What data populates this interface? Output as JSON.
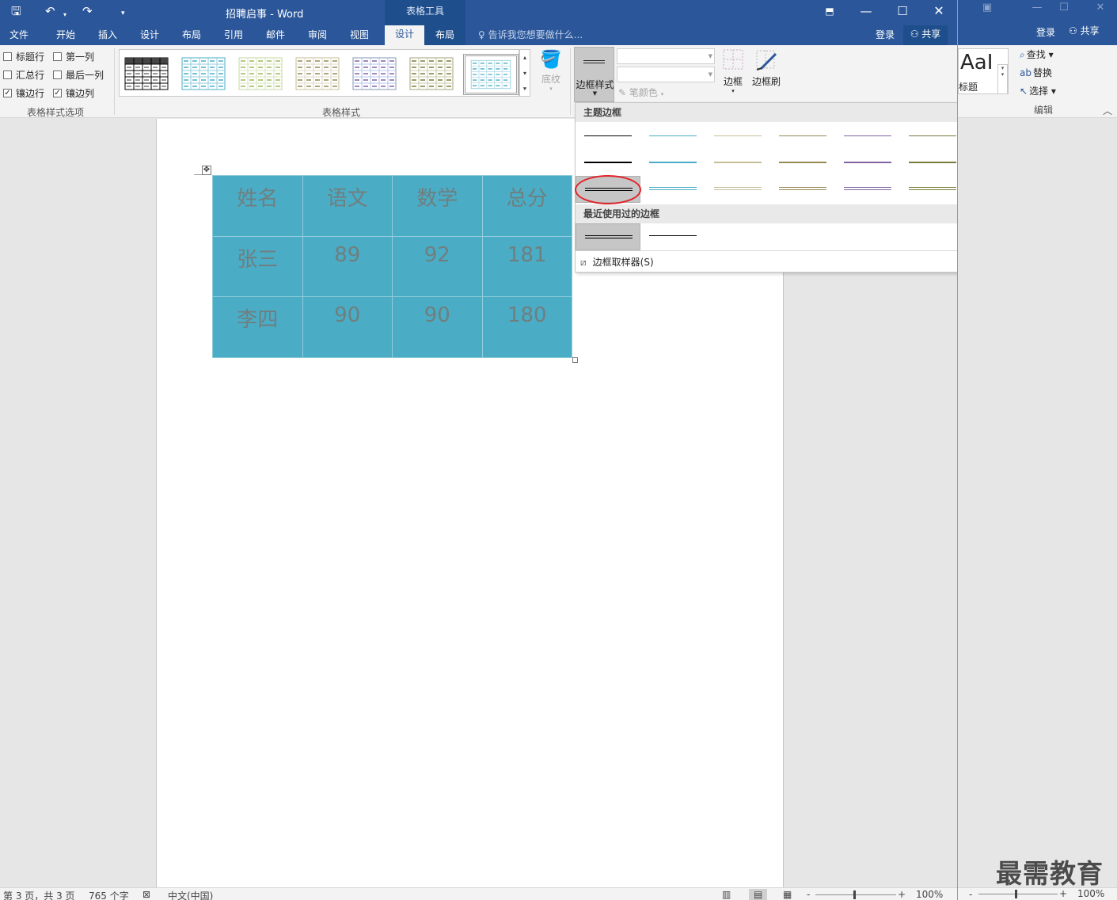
{
  "window": {
    "title": "招聘启事 - Word",
    "context_tool": "表格工具",
    "tabs": [
      "文件",
      "开始",
      "插入",
      "设计",
      "布局",
      "引用",
      "邮件",
      "审阅",
      "视图",
      "设计",
      "布局"
    ],
    "tell_me": "告诉我您想要做什么...",
    "login": "登录",
    "share": "共享"
  },
  "ribbon": {
    "options": {
      "header_row": "标题行",
      "first_col": "第一列",
      "total_row": "汇总行",
      "last_col": "最后一列",
      "banded_rows": "镶边行",
      "banded_cols": "镶边列",
      "checked": [
        "banded_rows",
        "banded_cols"
      ],
      "group_label": "表格样式选项"
    },
    "styles_group_label": "表格样式",
    "shading": "底纹",
    "border_style": "边框样式",
    "pen_color": "笔颜色",
    "borders": "边框",
    "border_painter": "边框刷"
  },
  "table": {
    "rows": [
      [
        "姓名",
        "语文",
        "数学",
        "总分"
      ],
      [
        "张三",
        "89",
        "92",
        "181"
      ],
      [
        "李四",
        "90",
        "90",
        "180"
      ]
    ],
    "fill_color": "#4bacc6",
    "text_color": "#6f7f7f"
  },
  "dropdown": {
    "theme_header": "主题边框",
    "recent_header": "最近使用过的边框",
    "sampler": "边框取样器(S)",
    "theme_colors": [
      "#000000",
      "#4bacc6",
      "#c4bd97",
      "#948a54",
      "#8064a2",
      "#7a7a3a",
      "#92cddc"
    ]
  },
  "bgwindow": {
    "login": "登录",
    "share": "共享",
    "find": "查找",
    "replace": "替换",
    "select": "选择",
    "edit_group": "编辑",
    "style_label": "标题",
    "style_sample": "AaI"
  },
  "status": {
    "page": "第 3 页，共 3 页",
    "words": "765 个字",
    "lang": "中文(中国)",
    "zoom": "100%",
    "zoom2": "100%"
  },
  "watermark": "最需教育"
}
